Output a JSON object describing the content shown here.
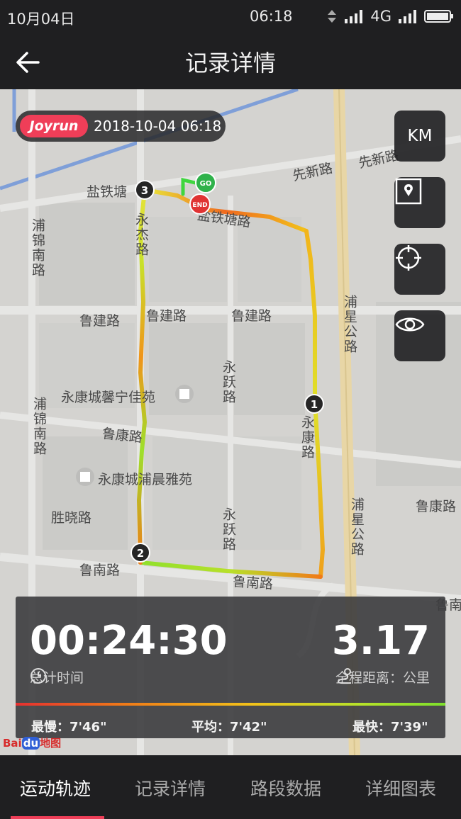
{
  "status_bar": {
    "date": "10月04日",
    "time": "06:18",
    "network": "4G"
  },
  "header": {
    "title": "记录详情"
  },
  "map": {
    "badge": {
      "brand": "Joyrun",
      "datetime": "2018-10-04 06:18"
    },
    "controls": {
      "unit": "KM"
    },
    "labels": {
      "l1": "先新路",
      "l2": "先新路",
      "l3": "盐铁塘",
      "l4": "盐铁塘路",
      "l5": "浦锦南路",
      "l6": "浦锦南路",
      "l7": "鲁建路",
      "l8": "鲁建路",
      "l9": "鲁建路",
      "l10": "永跃路",
      "l11": "永康城馨宁佳苑",
      "l12": "鲁康路",
      "l13": "永康城浦晨雅苑",
      "l14": "胜晓路",
      "l15": "鲁南路",
      "l16": "鲁南路",
      "l17": "永跃路",
      "l18": "浦星公路",
      "l19": "浦星公路",
      "l20": "鲁康路",
      "l21": "永杰路",
      "l22": "永康路",
      "l23": "鲁南"
    },
    "markers": {
      "go": "GO",
      "end": "END",
      "k1": "1",
      "k2": "2",
      "k3": "3"
    },
    "attribution": {
      "text": "Bai",
      "mid": "du",
      "tail": "地图"
    }
  },
  "stats": {
    "total_time": "00:24:30",
    "total_time_label": "总计时间",
    "distance": "3.17",
    "distance_label": "全程距离：公里",
    "slowest": "最慢：7'46\"",
    "average": "平均：7'42\"",
    "fastest": "最快：7'39\""
  },
  "tabs": [
    {
      "label": "运动轨迹",
      "active": true
    },
    {
      "label": "记录详情",
      "active": false
    },
    {
      "label": "路段数据",
      "active": false
    },
    {
      "label": "详细图表",
      "active": false
    }
  ],
  "colors": {
    "accent": "#ef3e58",
    "go": "#2fb24a",
    "end": "#e03333"
  }
}
